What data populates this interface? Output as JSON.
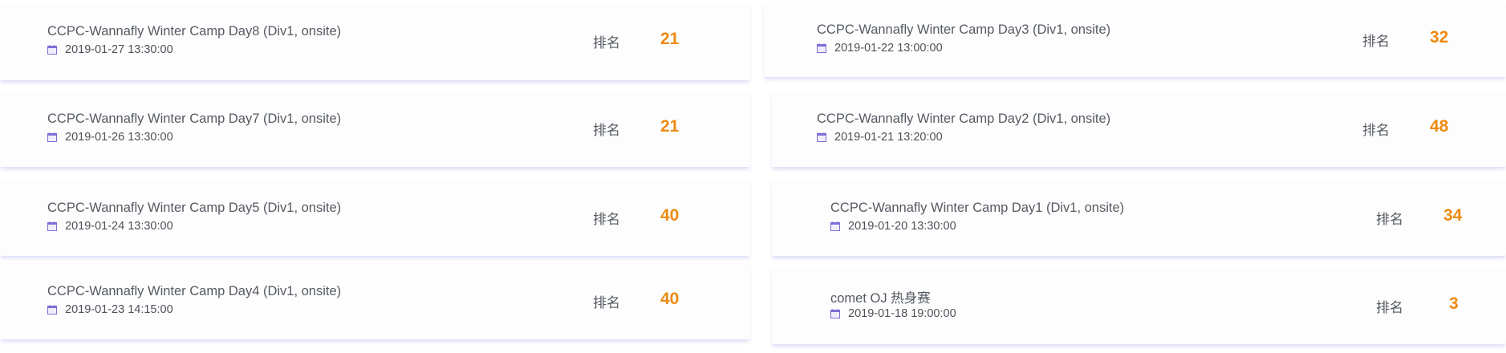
{
  "contests": [
    {
      "title": "CCPC-Wannafly Winter Camp Day8 (Div1, onsite)",
      "date": "2019-01-27 13:30:00",
      "rank_label": "排名",
      "rank": "21",
      "icon": "calendar-icon"
    },
    {
      "title": "CCPC-Wannafly Winter Camp Day7 (Div1, onsite)",
      "date": "2019-01-26 13:30:00",
      "rank_label": "排名",
      "rank": "21",
      "icon": "calendar-icon"
    },
    {
      "title": "CCPC-Wannafly Winter Camp Day5 (Div1, onsite)",
      "date": "2019-01-24 13:30:00",
      "rank_label": "排名",
      "rank": "40",
      "icon": "calendar-icon"
    },
    {
      "title": "CCPC-Wannafly Winter Camp Day4 (Div1, onsite)",
      "date": "2019-01-23 14:15:00",
      "rank_label": "排名",
      "rank": "40",
      "icon": "calendar-icon"
    },
    {
      "title": "CCPC-Wannafly Winter Camp Day3 (Div1, onsite)",
      "date": "2019-01-22 13:00:00",
      "rank_label": "排名",
      "rank": "32",
      "icon": "calendar-icon"
    },
    {
      "title": "CCPC-Wannafly Winter Camp Day2 (Div1, onsite)",
      "date": "2019-01-21 13:20:00",
      "rank_label": "排名",
      "rank": "48",
      "icon": "calendar-icon"
    },
    {
      "title": "CCPC-Wannafly Winter Camp Day1 (Div1, onsite)",
      "date": "2019-01-20 13:30:00",
      "rank_label": "排名",
      "rank": "34",
      "icon": "calendar-icon"
    },
    {
      "title": "comet OJ 热身赛",
      "date": "2019-01-18 19:00:00",
      "rank_label": "排名",
      "rank": "3",
      "icon": "calendar-icon"
    }
  ],
  "colors": {
    "rank": "#ee8a11",
    "text": "#555a61",
    "calendar_icon": "#7b6fd6",
    "card_shadow": "#b4b9eb"
  }
}
